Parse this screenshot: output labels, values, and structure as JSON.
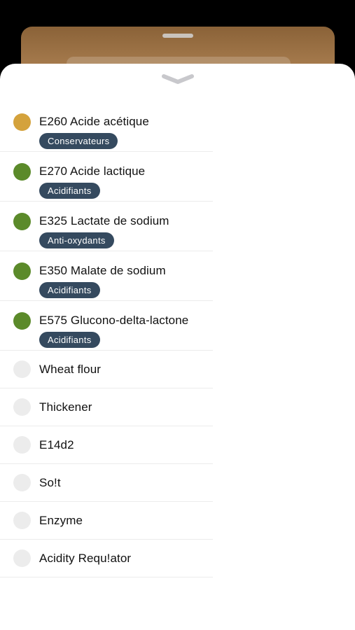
{
  "colors": {
    "orange_dot": "#d4a23c",
    "green_dot": "#5b8a2a",
    "grey_dot": "#ececec",
    "tag_bg": "#354a5f"
  },
  "sheet": {
    "handle_icon": "chevron-down-icon"
  },
  "additives": [
    {
      "name": "E260 Acide acétique",
      "tag": "Conservateurs",
      "dot": "orange"
    },
    {
      "name": "E270 Acide lactique",
      "tag": "Acidifiants",
      "dot": "green"
    },
    {
      "name": "E325 Lactate de sodium",
      "tag": "Anti-oxydants",
      "dot": "green"
    },
    {
      "name": "E350 Malate de sodium",
      "tag": "Acidifiants",
      "dot": "green"
    },
    {
      "name": "E575 Glucono-delta-lactone",
      "tag": "Acidifiants",
      "dot": "green"
    }
  ],
  "ingredients": [
    {
      "name": "Wheat flour",
      "dot": "grey"
    },
    {
      "name": "Thickener",
      "dot": "grey"
    },
    {
      "name": "E14d2",
      "dot": "grey"
    },
    {
      "name": "So!t",
      "dot": "grey"
    },
    {
      "name": "Enzyme",
      "dot": "grey"
    },
    {
      "name": "Acidity Requ!ator",
      "dot": "grey"
    }
  ]
}
